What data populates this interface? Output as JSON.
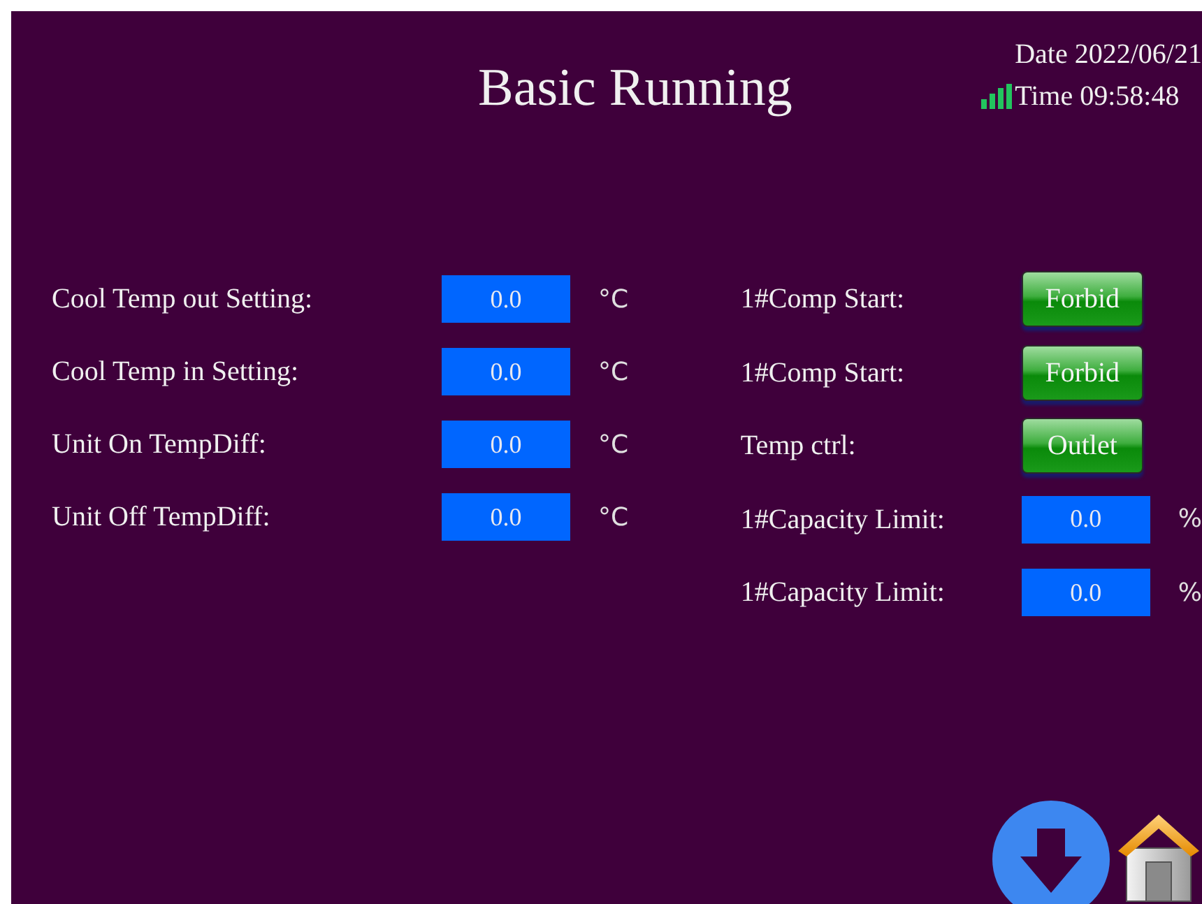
{
  "title": "Basic Running",
  "date": {
    "label": "Date",
    "value": "2022/06/21"
  },
  "time": {
    "label": "Time",
    "value": "09:58:48"
  },
  "left_settings": [
    {
      "label": "Cool Temp out Setting:",
      "value": "0.0",
      "unit": "°C"
    },
    {
      "label": "Cool Temp in Setting:",
      "value": "0.0",
      "unit": "°C"
    },
    {
      "label": "Unit On TempDiff:",
      "value": "0.0",
      "unit": "°C"
    },
    {
      "label": "Unit Off TempDiff:",
      "value": "0.0",
      "unit": "°C"
    }
  ],
  "right_settings": [
    {
      "kind": "button",
      "label": "1#Comp Start:",
      "value": "Forbid"
    },
    {
      "kind": "button",
      "label": "1#Comp Start:",
      "value": "Forbid"
    },
    {
      "kind": "button",
      "label": "Temp ctrl:",
      "value": "Outlet"
    },
    {
      "kind": "field",
      "label": "1#Capacity Limit:",
      "value": "0.0",
      "unit": "%"
    },
    {
      "kind": "field",
      "label": "1#Capacity Limit:",
      "value": "0.0",
      "unit": "%"
    }
  ]
}
